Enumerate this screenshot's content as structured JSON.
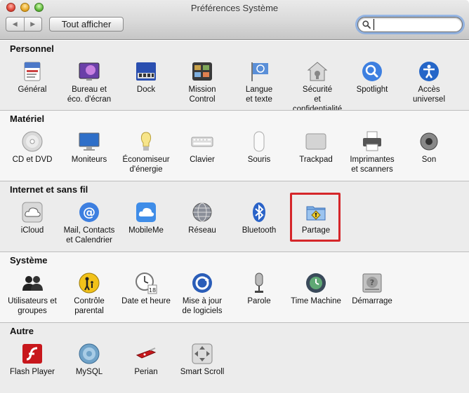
{
  "window": {
    "title": "Préférences Système",
    "back_label": "◀",
    "forward_label": "▶",
    "show_all_label": "Tout afficher",
    "search": {
      "value": "",
      "placeholder": ""
    }
  },
  "sections": {
    "personnel": {
      "title": "Personnel",
      "items": [
        {
          "label": "Général",
          "icon": "general-icon"
        },
        {
          "label": "Bureau et\néco. d'écran",
          "icon": "desktop-icon"
        },
        {
          "label": "Dock",
          "icon": "dock-icon"
        },
        {
          "label": "Mission\nControl",
          "icon": "mission-control-icon"
        },
        {
          "label": "Langue\net texte",
          "icon": "language-icon"
        },
        {
          "label": "Sécurité\net confidentialité",
          "icon": "security-icon"
        },
        {
          "label": "Spotlight",
          "icon": "spotlight-icon"
        },
        {
          "label": "Accès\nuniversel",
          "icon": "accessibility-icon"
        }
      ]
    },
    "materiel": {
      "title": "Matériel",
      "items": [
        {
          "label": "CD et DVD",
          "icon": "cd-dvd-icon"
        },
        {
          "label": "Moniteurs",
          "icon": "displays-icon"
        },
        {
          "label": "Économiseur\nd'énergie",
          "icon": "energy-saver-icon"
        },
        {
          "label": "Clavier",
          "icon": "keyboard-icon"
        },
        {
          "label": "Souris",
          "icon": "mouse-icon"
        },
        {
          "label": "Trackpad",
          "icon": "trackpad-icon"
        },
        {
          "label": "Imprimantes\net scanners",
          "icon": "printer-icon"
        },
        {
          "label": "Son",
          "icon": "sound-icon"
        }
      ]
    },
    "internet": {
      "title": "Internet et sans fil",
      "items": [
        {
          "label": "iCloud",
          "icon": "icloud-icon"
        },
        {
          "label": "Mail, Contacts\net Calendrier",
          "icon": "mail-icon"
        },
        {
          "label": "MobileMe",
          "icon": "mobileme-icon"
        },
        {
          "label": "Réseau",
          "icon": "network-icon"
        },
        {
          "label": "Bluetooth",
          "icon": "bluetooth-icon"
        },
        {
          "label": "Partage",
          "icon": "sharing-icon"
        }
      ]
    },
    "systeme": {
      "title": "Système",
      "items": [
        {
          "label": "Utilisateurs et\ngroupes",
          "icon": "users-icon"
        },
        {
          "label": "Contrôle\nparental",
          "icon": "parental-controls-icon"
        },
        {
          "label": "Date et heure",
          "icon": "date-time-icon"
        },
        {
          "label": "Mise à jour\nde logiciels",
          "icon": "software-update-icon"
        },
        {
          "label": "Parole",
          "icon": "speech-icon"
        },
        {
          "label": "Time Machine",
          "icon": "time-machine-icon"
        },
        {
          "label": "Démarrage",
          "icon": "startup-disk-icon"
        }
      ]
    },
    "autre": {
      "title": "Autre",
      "items": [
        {
          "label": "Flash Player",
          "icon": "flash-player-icon"
        },
        {
          "label": "MySQL",
          "icon": "mysql-icon"
        },
        {
          "label": "Perian",
          "icon": "perian-icon"
        },
        {
          "label": "Smart Scroll",
          "icon": "smart-scroll-icon"
        }
      ]
    }
  },
  "colors": {
    "highlight": "#d5262a",
    "section_alt": "#ececec",
    "section_plain": "#f6f6f6"
  }
}
